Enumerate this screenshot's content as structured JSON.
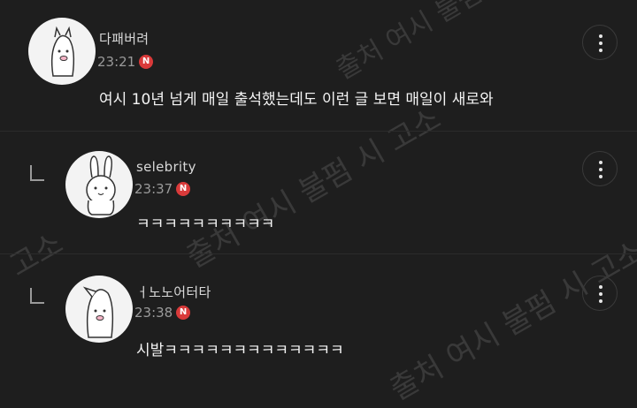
{
  "comments": [
    {
      "author": "다패버려",
      "time": "23:21",
      "badge": "N",
      "text": "여시 10년 넘게 매일 출석했는데도 이런 글 보면 매일이 새로와"
    },
    {
      "author": "selebrity",
      "time": "23:37",
      "badge": "N",
      "text": "ㅋㅋㅋㅋㅋㅋㅋㅋㅋㅋ"
    },
    {
      "author": "ㅓ노노어터타",
      "time": "23:38",
      "badge": "N",
      "text": "시발ㅋㅋㅋㅋㅋㅋㅋㅋㅋㅋㅋㅋㅋ"
    }
  ],
  "watermark": {
    "text1": "출처 여시 불펌 시 고소",
    "text2": "고소"
  },
  "icons": {
    "more": "more-vertical-icon",
    "reply": "reply-arrow-icon",
    "badge": "new-badge-icon"
  }
}
